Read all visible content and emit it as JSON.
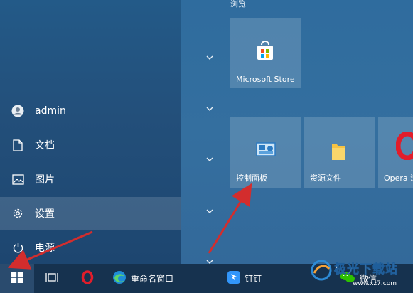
{
  "start_menu": {
    "left": {
      "user": "admin",
      "items": [
        {
          "label": "文档",
          "icon": "document-icon"
        },
        {
          "label": "图片",
          "icon": "picture-icon"
        },
        {
          "label": "设置",
          "icon": "gear-icon"
        },
        {
          "label": "电源",
          "icon": "power-icon"
        }
      ]
    },
    "right": {
      "group_title": "浏览",
      "tiles": [
        {
          "label": "Microsoft Store",
          "icon": "store-icon"
        },
        {
          "label": "控制面板",
          "icon": "control-panel-icon"
        },
        {
          "label": "资源文件",
          "icon": "folder-icon"
        },
        {
          "label": "Opera 浏览",
          "icon": "opera-icon"
        }
      ]
    }
  },
  "taskbar": {
    "items": [
      {
        "label": "",
        "icon": "windows-start-icon"
      },
      {
        "label": "",
        "icon": "task-view-icon"
      },
      {
        "label": "",
        "icon": "opera-icon"
      },
      {
        "label": "重命名窗口",
        "icon": "edge-icon"
      },
      {
        "label": "钉钉",
        "icon": "dingtalk-icon"
      },
      {
        "label": "微信",
        "icon": "wechat-icon"
      }
    ]
  },
  "watermark": {
    "text": "极光下载站",
    "url": "www.xz7.com"
  },
  "colors": {
    "accent_arrow": "#d32d2d",
    "taskbar": "#16324f",
    "left_pane": "#234f7a",
    "right_pane": "#346f9f"
  }
}
